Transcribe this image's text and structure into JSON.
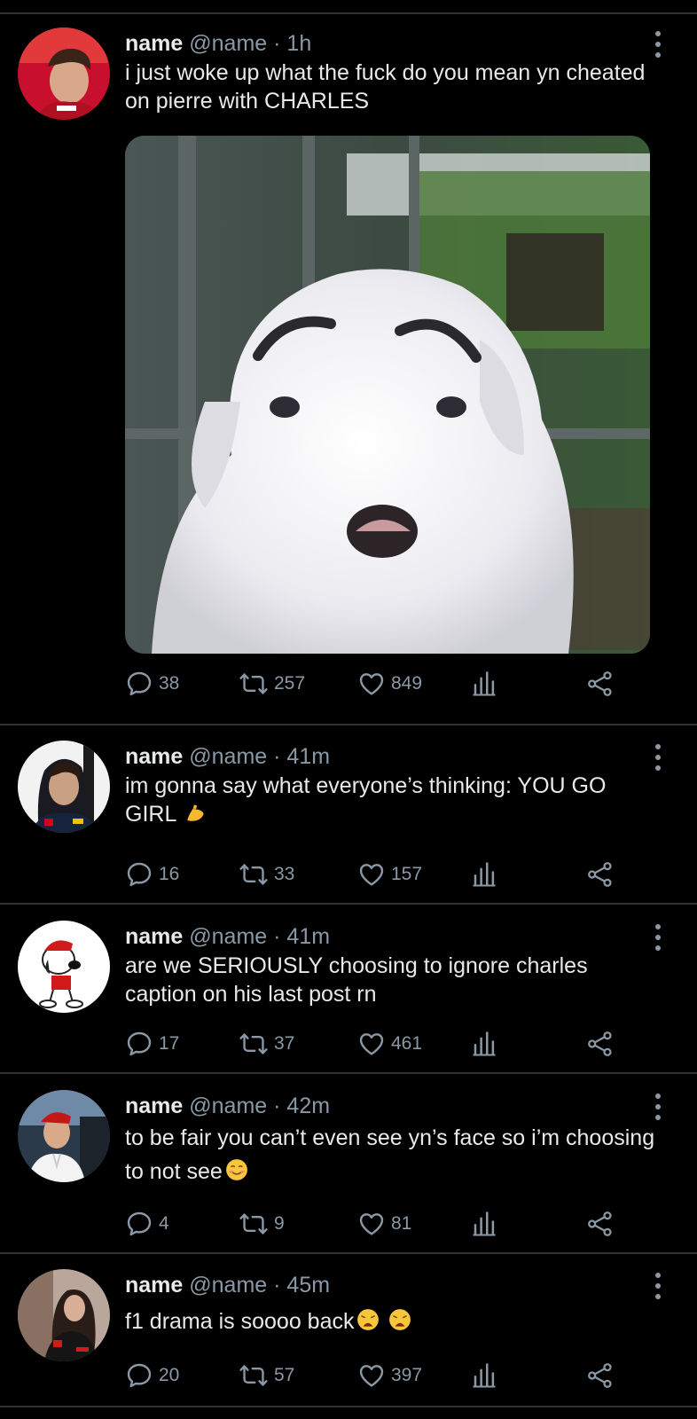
{
  "tweets": [
    {
      "name": "name",
      "handle": "@name",
      "separator": "·",
      "time": "1h",
      "text": "i just woke up what the fuck do you mean yn cheated on pierre with CHARLES",
      "replies": "38",
      "retweets": "257",
      "likes": "849",
      "avatar": "avatar-red-cap-driver",
      "media": "white-puppy-with-drawn-eyebrows"
    },
    {
      "name": "name",
      "handle": "@name",
      "separator": "·",
      "time": "41m",
      "text": "im gonna say what everyone’s thinking: YOU GO GIRL",
      "emoji": "flexed-biceps",
      "replies": "16",
      "retweets": "33",
      "likes": "157",
      "avatar": "avatar-driver-team-jacket"
    },
    {
      "name": "name",
      "handle": "@name",
      "separator": "·",
      "time": "41m",
      "text": "are we SERIOUSLY choosing to ignore charles caption on his last post rn",
      "replies": "17",
      "retweets": "37",
      "likes": "461",
      "avatar": "avatar-snoopy-red-cap"
    },
    {
      "name": "name",
      "handle": "@name",
      "separator": "·",
      "time": "42m",
      "text": "to be fair you can’t even see yn’s face so i’m choosing to not see",
      "emoji": "smiling-face",
      "replies": "4",
      "retweets": "9",
      "likes": "81",
      "avatar": "avatar-man-white-shirt"
    },
    {
      "name": "name",
      "handle": "@name",
      "separator": "·",
      "time": "45m",
      "text": "f1 drama is soooo back",
      "emoji": "weary-face",
      "replies": "20",
      "retweets": "57",
      "likes": "397",
      "avatar": "avatar-woman-racing-jacket"
    }
  ],
  "icons": {
    "reply": "reply-icon",
    "retweet": "retweet-icon",
    "like": "heart-icon",
    "views": "views-icon",
    "share": "share-icon",
    "more": "more-vertical-icon"
  },
  "colors": {
    "background": "#000000",
    "text": "#e7e9ea",
    "muted": "#8b98a5",
    "divider": "#2f3336"
  }
}
